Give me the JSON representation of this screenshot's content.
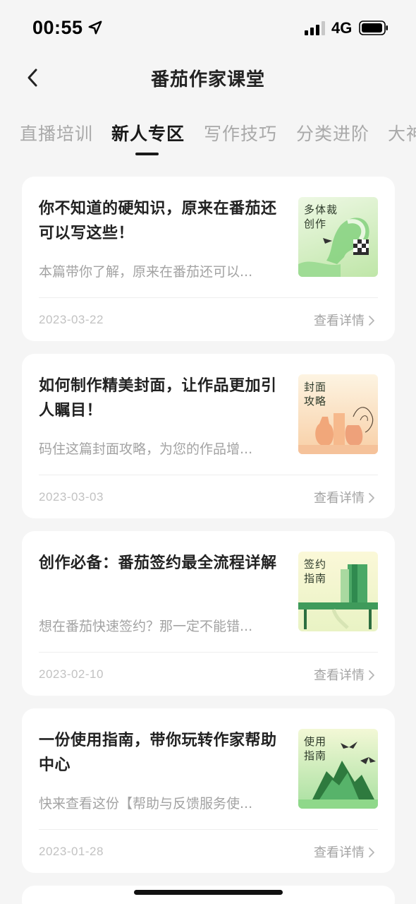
{
  "status_bar": {
    "time": "00:55",
    "network": "4G"
  },
  "nav": {
    "title": "番茄作家课堂"
  },
  "tabs": [
    {
      "label": "直播培训",
      "active": false
    },
    {
      "label": "新人专区",
      "active": true
    },
    {
      "label": "写作技巧",
      "active": false
    },
    {
      "label": "分类进阶",
      "active": false
    },
    {
      "label": "大神",
      "active": false
    }
  ],
  "cards": [
    {
      "title": "你不知道的硬知识，原来在番茄还可以写这些！",
      "desc": "本篇带你了解，原来在番茄还可以...",
      "date": "2023-03-22",
      "more": "查看详情",
      "thumb_caption_1": "多体裁",
      "thumb_caption_2": "创作",
      "thumb_colors": [
        "#e6f5d8",
        "#b7e3a4"
      ]
    },
    {
      "title": "如何制作精美封面，让作品更加引人瞩目！",
      "desc": "码住这篇封面攻略，为您的作品增...",
      "date": "2023-03-03",
      "more": "查看详情",
      "thumb_caption_1": "封面",
      "thumb_caption_2": "攻略",
      "thumb_colors": [
        "#fdf1dc",
        "#f7c9a0"
      ]
    },
    {
      "title": "创作必备：番茄签约最全流程详解",
      "desc": "想在番茄快速签约？那一定不能错...",
      "date": "2023-02-10",
      "more": "查看详情",
      "thumb_caption_1": "签约",
      "thumb_caption_2": "指南",
      "thumb_colors": [
        "#f8f6d4",
        "#cfeab2"
      ]
    },
    {
      "title": "一份使用指南，带你玩转作家帮助中心",
      "desc": "快来查看这份【帮助与反馈服务使...",
      "date": "2023-01-28",
      "more": "查看详情",
      "thumb_caption_1": "使用",
      "thumb_caption_2": "指南",
      "thumb_colors": [
        "#f2f7d2",
        "#9fdc98"
      ]
    }
  ]
}
